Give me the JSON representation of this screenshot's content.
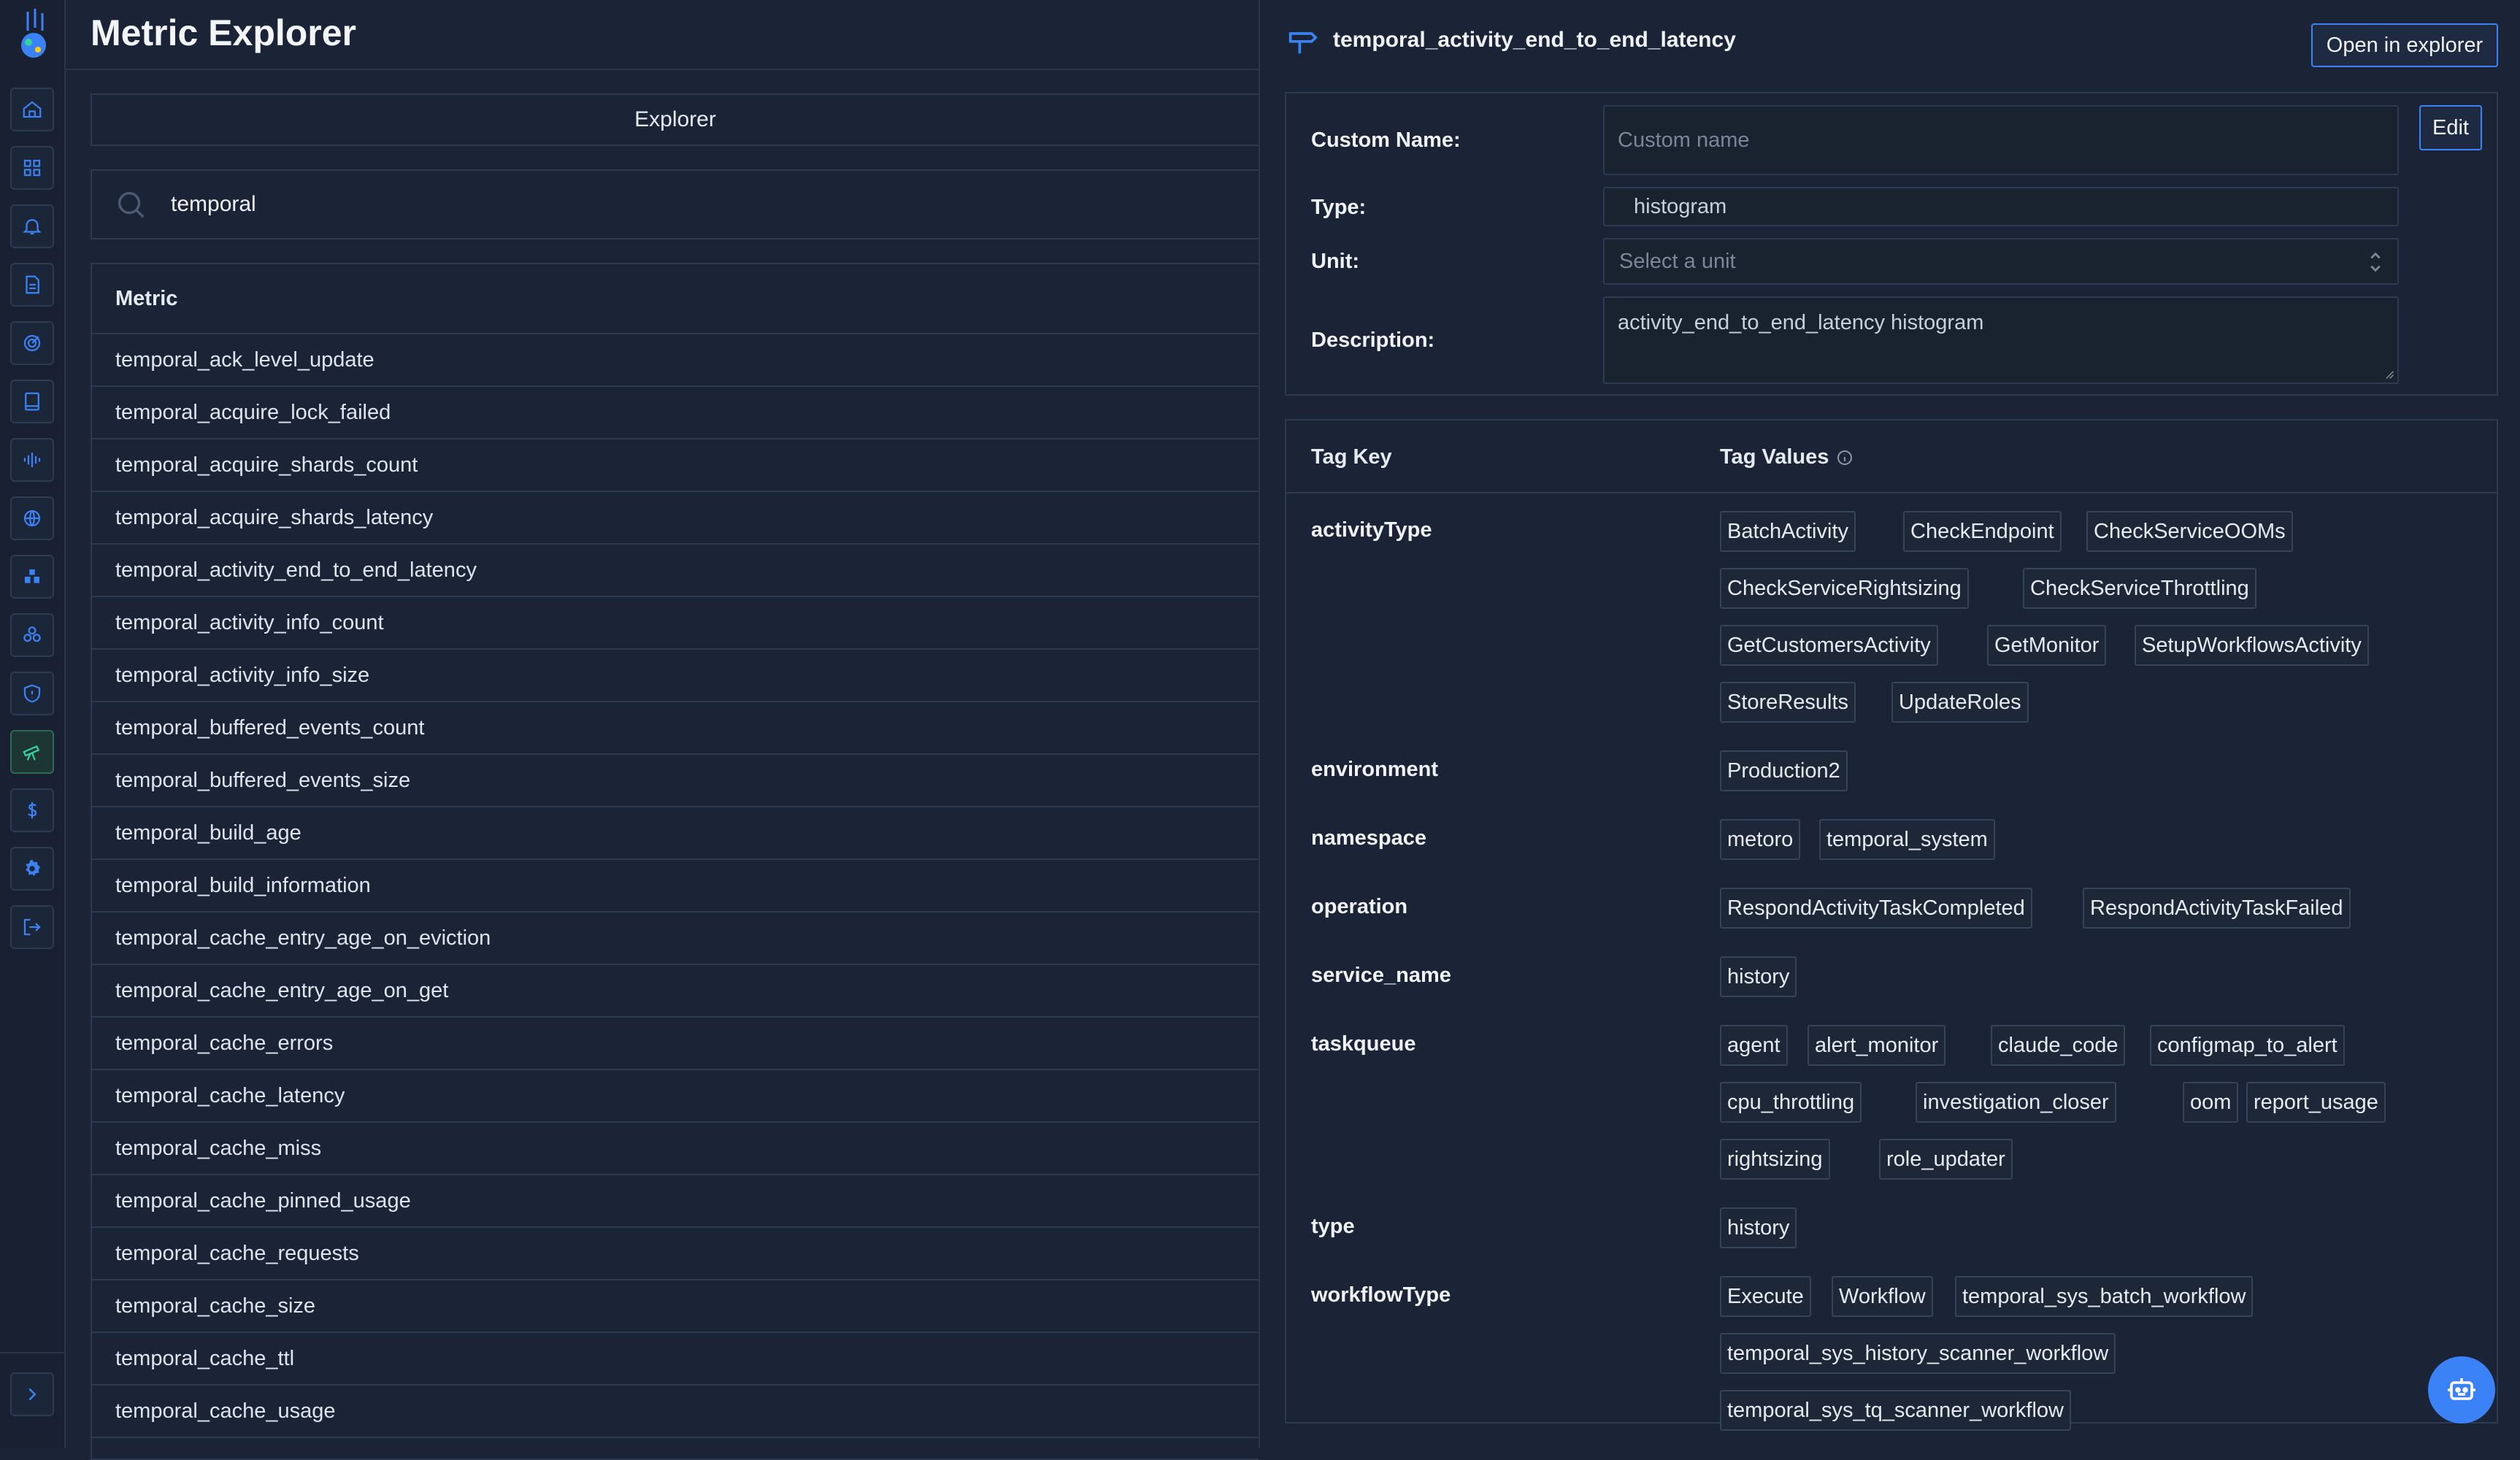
{
  "app": {
    "page_title": "Metric Explorer",
    "accent": "#3b82f6",
    "active_accent": "#34d399"
  },
  "sidebar": {
    "items": [
      {
        "name": "home-icon"
      },
      {
        "name": "dashboard-icon"
      },
      {
        "name": "bell-icon"
      },
      {
        "name": "document-icon"
      },
      {
        "name": "target-icon"
      },
      {
        "name": "book-icon"
      },
      {
        "name": "waveform-icon"
      },
      {
        "name": "globe-icon"
      },
      {
        "name": "cubes-icon"
      },
      {
        "name": "hexagons-icon"
      },
      {
        "name": "shield-icon"
      },
      {
        "name": "telescope-icon",
        "active": true
      },
      {
        "name": "dollar-icon"
      },
      {
        "name": "gear-icon"
      },
      {
        "name": "logout-icon"
      }
    ],
    "expand_icon": "chevron-right-icon"
  },
  "explorer": {
    "tab_label": "Explorer",
    "search": {
      "value": "temporal"
    },
    "column_header": "Metric",
    "metrics": [
      "temporal_ack_level_update",
      "temporal_acquire_lock_failed",
      "temporal_acquire_shards_count",
      "temporal_acquire_shards_latency",
      "temporal_activity_end_to_end_latency",
      "temporal_activity_info_count",
      "temporal_activity_info_size",
      "temporal_buffered_events_count",
      "temporal_buffered_events_size",
      "temporal_build_age",
      "temporal_build_information",
      "temporal_cache_entry_age_on_eviction",
      "temporal_cache_entry_age_on_get",
      "temporal_cache_errors",
      "temporal_cache_latency",
      "temporal_cache_miss",
      "temporal_cache_pinned_usage",
      "temporal_cache_requests",
      "temporal_cache_size",
      "temporal_cache_ttl",
      "temporal_cache_usage"
    ]
  },
  "detail": {
    "metric_name": "temporal_activity_end_to_end_latency",
    "open_button": "Open in explorer",
    "edit_button": "Edit",
    "custom_name_label": "Custom Name:",
    "custom_name_placeholder": "Custom name",
    "type_label": "Type:",
    "type_value": "histogram",
    "unit_label": "Unit:",
    "unit_placeholder": "Select a unit",
    "description_label": "Description:",
    "description_value": "activity_end_to_end_latency histogram",
    "tag_key_header": "Tag Key",
    "tag_values_header": "Tag Values",
    "tags": [
      {
        "key": "activityType",
        "values": [
          "BatchActivity",
          "CheckEndpoint",
          "CheckServiceOOMs",
          "CheckServiceRightsizing",
          "CheckServiceThrottling",
          "GetCustomersActivity",
          "GetMonitor",
          "SetupWorkflowsActivity",
          "StoreResults",
          "UpdateRoles"
        ]
      },
      {
        "key": "environment",
        "values": [
          "Production2"
        ]
      },
      {
        "key": "namespace",
        "values": [
          "metoro",
          "temporal_system"
        ]
      },
      {
        "key": "operation",
        "values": [
          "RespondActivityTaskCompleted",
          "RespondActivityTaskFailed"
        ]
      },
      {
        "key": "service_name",
        "values": [
          "history"
        ]
      },
      {
        "key": "taskqueue",
        "values": [
          "agent",
          "alert_monitor",
          "claude_code",
          "configmap_to_alert",
          "cpu_throttling",
          "investigation_closer",
          "oom",
          "report_usage",
          "rightsizing",
          "role_updater"
        ]
      },
      {
        "key": "type",
        "values": [
          "history"
        ]
      },
      {
        "key": "workflowType",
        "values": [
          "Execute",
          "Workflow",
          "temporal_sys_batch_workflow",
          "temporal_sys_history_scanner_workflow",
          "temporal_sys_tq_scanner_workflow"
        ]
      }
    ]
  },
  "assistant_button": {
    "icon": "robot-icon"
  }
}
